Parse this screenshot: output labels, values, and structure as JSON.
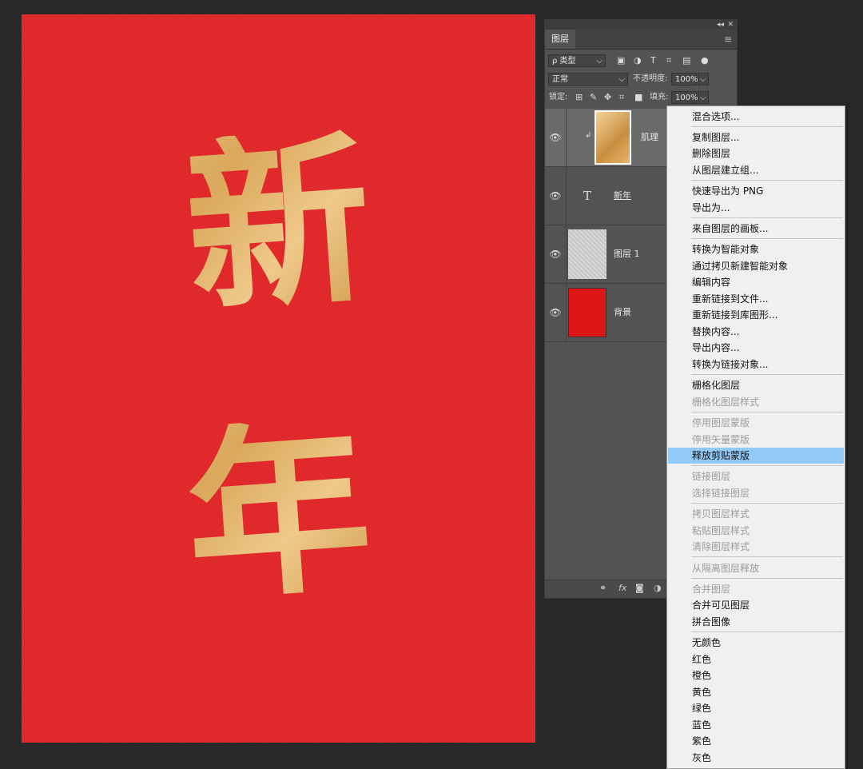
{
  "canvas": {
    "char1": "新",
    "char2": "年"
  },
  "layers_panel": {
    "tab_label": "图层",
    "filter_label": "ρ 类型",
    "blend_mode": "正常",
    "opacity_label": "不透明度:",
    "opacity_value": "100%",
    "lock_label": "锁定:",
    "fill_label": "填充:",
    "fill_value": "100%",
    "layers": [
      {
        "name": "肌理",
        "type": "clipped"
      },
      {
        "name": "新年",
        "type": "text"
      },
      {
        "name": "图层 1",
        "type": "texture"
      },
      {
        "name": "背景",
        "type": "background"
      }
    ],
    "bottom_fx": "fx"
  },
  "context_menu": {
    "items": [
      {
        "label": "混合选项...",
        "enabled": true
      },
      {
        "label": "复制图层...",
        "enabled": true
      },
      {
        "label": "删除图层",
        "enabled": true
      },
      {
        "label": "从图层建立组...",
        "enabled": true
      },
      {
        "label": "快速导出为 PNG",
        "enabled": true
      },
      {
        "label": "导出为...",
        "enabled": true
      },
      {
        "label": "来自图层的画板...",
        "enabled": true
      },
      {
        "label": "转换为智能对象",
        "enabled": true
      },
      {
        "label": "通过拷贝新建智能对象",
        "enabled": true
      },
      {
        "label": "编辑内容",
        "enabled": true
      },
      {
        "label": "重新链接到文件...",
        "enabled": true
      },
      {
        "label": "重新链接到库图形...",
        "enabled": true
      },
      {
        "label": "替换内容...",
        "enabled": true
      },
      {
        "label": "导出内容...",
        "enabled": true
      },
      {
        "label": "转换为链接对象...",
        "enabled": true
      },
      {
        "label": "栅格化图层",
        "enabled": true
      },
      {
        "label": "栅格化图层样式",
        "enabled": false
      },
      {
        "label": "停用图层蒙版",
        "enabled": false
      },
      {
        "label": "停用矢量蒙版",
        "enabled": false
      },
      {
        "label": "释放剪贴蒙版",
        "enabled": true,
        "highlighted": true
      },
      {
        "label": "链接图层",
        "enabled": false
      },
      {
        "label": "选择链接图层",
        "enabled": false
      },
      {
        "label": "拷贝图层样式",
        "enabled": false
      },
      {
        "label": "粘贴图层样式",
        "enabled": false
      },
      {
        "label": "清除图层样式",
        "enabled": false
      },
      {
        "label": "从隔离图层释放",
        "enabled": false
      },
      {
        "label": "合并图层",
        "enabled": false
      },
      {
        "label": "合并可见图层",
        "enabled": true
      },
      {
        "label": "拼合图像",
        "enabled": true
      },
      {
        "label": "无颜色",
        "enabled": true
      },
      {
        "label": "红色",
        "enabled": true
      },
      {
        "label": "橙色",
        "enabled": true
      },
      {
        "label": "黄色",
        "enabled": true
      },
      {
        "label": "绿色",
        "enabled": true
      },
      {
        "label": "蓝色",
        "enabled": true
      },
      {
        "label": "紫色",
        "enabled": true
      },
      {
        "label": "灰色",
        "enabled": true
      }
    ]
  }
}
